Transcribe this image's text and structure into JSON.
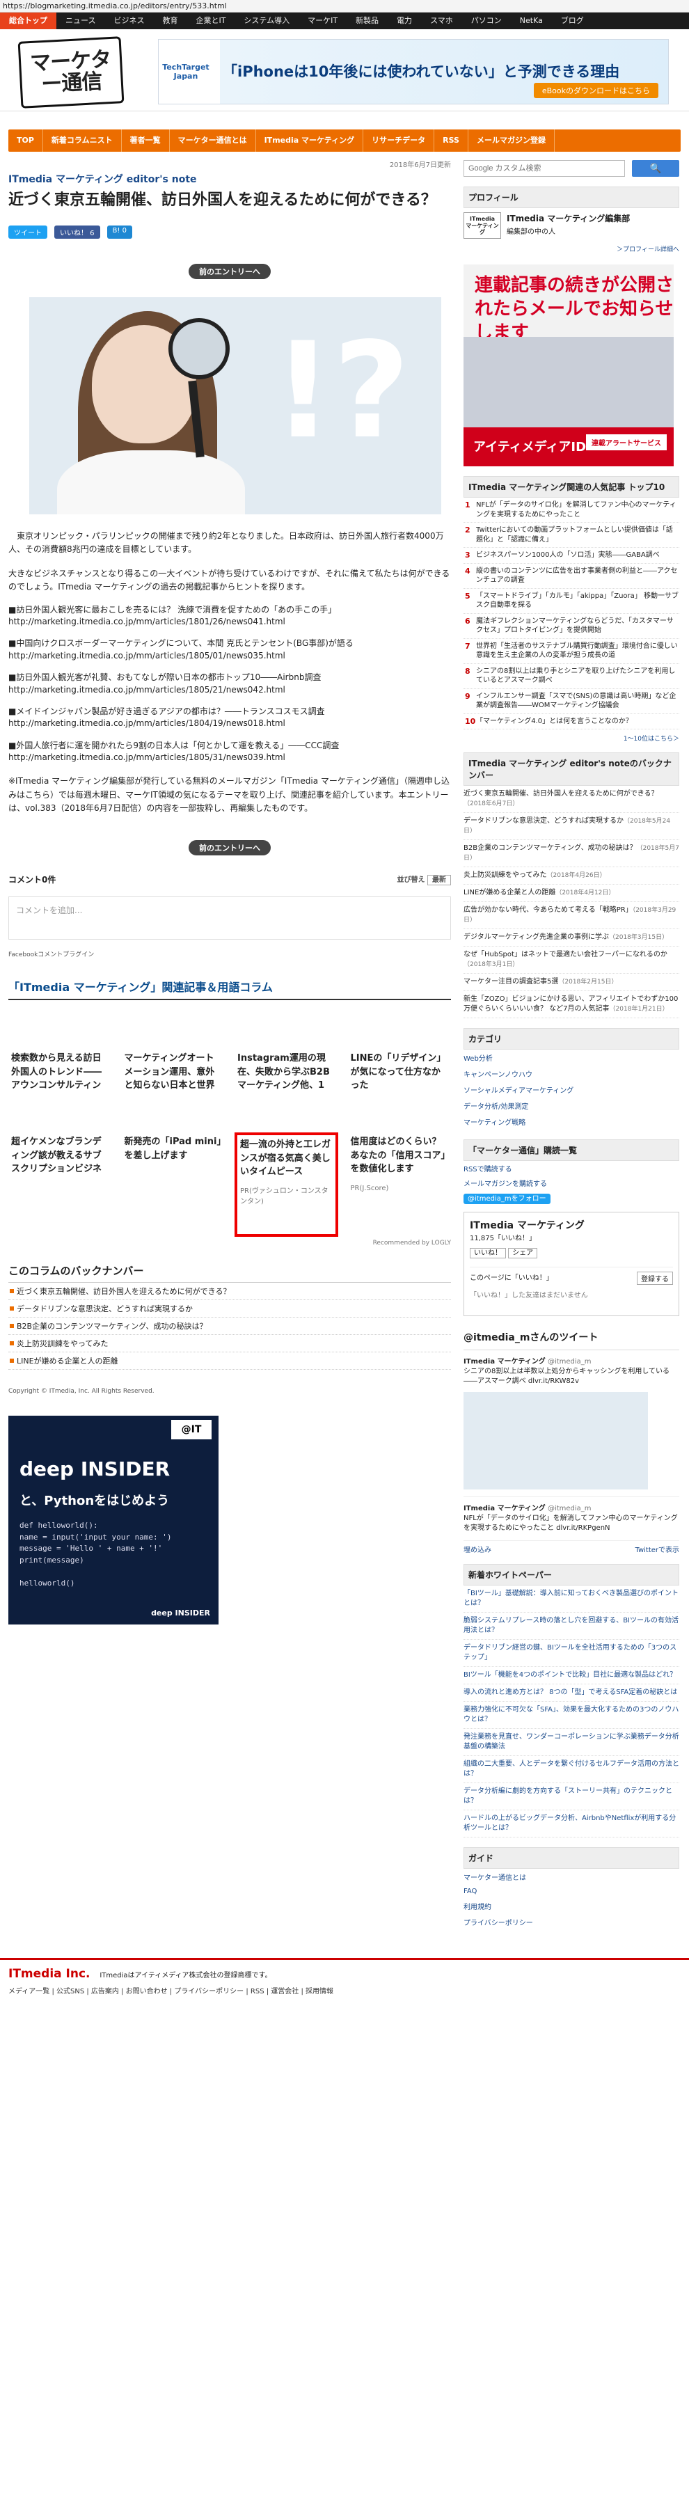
{
  "url": "https://blogmarketing.itmedia.co.jp/editors/entry/533.html",
  "topnav": [
    "総合トップ",
    "ニュース",
    "ビジネス",
    "教育",
    "企業とIT",
    "システム導入",
    "マーケIT",
    "新製品",
    "電力",
    "スマホ",
    "パソコン",
    "NetKa",
    "ブログ"
  ],
  "logo": "マーケター通信",
  "banner": {
    "brand": "TechTarget Japan",
    "title": "「iPhoneは10年後には使われていない」と予測できる理由",
    "button": "eBookのダウンロードはこちら"
  },
  "orangenav": [
    "TOP",
    "新着コラムニスト",
    "著者一覧",
    "マーケター通信とは",
    "ITmedia マーケティング",
    "リサーチデータ",
    "RSS",
    "メールマガジン登録"
  ],
  "article": {
    "date": "2018年6月7日更新",
    "series": "ITmedia マーケティング editor's note",
    "title": "近づく東京五輪開催、訪日外国人を迎えるために何ができる？",
    "share": [
      "ツイート",
      "いいね！ 6",
      "B! 0"
    ],
    "prev": "前のエントリーへ",
    "lead": "東京オリンピック・パラリンピックの開催まで残り約2年となりました。日本政府は、訪日外国人旅行者数4000万人、その消費額8兆円の達成を目標としています。",
    "p2": "大きなビジネスチャンスとなり得るこの一大イベントが待ち受けているわけですが、それに備えて私たちは何ができるのでしょう。ITmedia マーケティングの過去の掲載記事からヒントを探ります。",
    "items": [
      {
        "k": "■訪日外国人観光客に最おこしを売るには？ 洗練で消費を促すための「あの手この手」",
        "u": "http://marketing.itmedia.co.jp/mm/articles/1801/26/news041.html"
      },
      {
        "k": "■中国向けクロスボーダーマーケティングについて、本間 克氏とテンセント(BG事部)が語る",
        "u": "http://marketing.itmedia.co.jp/mm/articles/1805/01/news035.html"
      },
      {
        "k": "■訪日外国人観光客が礼賛、おもてなしが際い日本の都市トップ10――Airbnb調査",
        "u": "http://marketing.itmedia.co.jp/mm/articles/1805/21/news042.html"
      },
      {
        "k": "■メイドインジャパン製品が好き過ぎるアジアの都市は？――トランスコスモス調査",
        "u": "http://marketing.itmedia.co.jp/mm/articles/1804/19/news018.html"
      },
      {
        "k": "■外国人旅行者に運を開かれたら9割の日本人は「何とかして運を教える」――CCC調査",
        "u": "http://marketing.itmedia.co.jp/mm/articles/1805/31/news039.html"
      }
    ],
    "closing": "※ITmedia マーケティング編集部が発行している無料のメールマガジン「ITmedia マーケティング通信」（隔週申し込みはこちら）では毎週木曜日、マーケIT領域の気になるテーマを取り上げ、関連記事を紹介しています。本エントリーは、vol.383（2018年6月7日配信）の内容を一部抜粋し、再編集したものです。",
    "prev2": "前のエントリーへ"
  },
  "comments": {
    "count": "コメント0件",
    "sort_label": "並び替え",
    "sort_value": "最新",
    "placeholder": "コメントを追加...",
    "plugin": "Facebookコメントプラグイン"
  },
  "related": {
    "heading": "「ITmedia マーケティング」関連記事＆用語コラム",
    "cards": [
      {
        "t": "検索数から見える訪日外国人のトレンド――アウンコンサルティン",
        "pr": ""
      },
      {
        "t": "マーケティングオートメーション運用、意外と知らない日本と世界",
        "pr": ""
      },
      {
        "t": "Instagram運用の現在、失敗から学ぶB2Bマーケティング他、1",
        "pr": ""
      },
      {
        "t": "LINEの「リデザイン」が気になって仕方なかった",
        "pr": ""
      },
      {
        "t": "超イケメンなブランディング該が教えるサブスクリプションビジネ",
        "pr": ""
      },
      {
        "t": "新発売の「iPad mini」を差し上げます",
        "pr": ""
      },
      {
        "t": "超一流の外持と工レガンスが宿る気高く美しいタイムピース",
        "pr": "PR(ヴァシュロン・コンスタンタン)"
      },
      {
        "t": "信用度はどのくらい？あなたの「信用スコア」を数値化します",
        "pr": "PR(J.Score)"
      }
    ],
    "reco": "Recommended by LOGLY"
  },
  "backnumber": {
    "heading": "このコラムのバックナンバー",
    "items": [
      "近づく東京五輪開催、訪日外国人を迎えるために何ができる？",
      "データドリブンな意思決定、どうすれば実現するか",
      "B2B企業のコンテンツマーケティング、成功の秘訣は？",
      "炎上防災訓練をやってみた",
      "LINEが嫌める企業と人の距離"
    ]
  },
  "copyright": "Copyright © ITmedia, Inc. All Rights Reserved.",
  "bottom_ad": {
    "badge": "@IT",
    "title": "deep INSIDER",
    "sub": "と、Pythonをはじめよう",
    "code": [
      "def helloworld():",
      "    name = input('input your name: ')",
      "    message = 'Hello ' + name + '!'",
      "    print(message)",
      "",
      "helloworld()"
    ],
    "brand": "deep INSIDER"
  },
  "sidebar": {
    "search_placeholder": "Google カスタム検索",
    "profile_h": "プロフィール",
    "profile_name": "ITmedia マーケティング編集部",
    "profile_role": "編集部の中の人",
    "profile_more": "＞プロフィール詳細へ",
    "ad": {
      "title": "連載記事の続きが公開されたらメールでお知らせします",
      "brand": "アイティメディアID",
      "cta": "連載アラートサービス"
    },
    "rank_h": "ITmedia マーケティング関連の人気記事 トップ10",
    "rank": [
      "NFLが「データのサイロ化」を解消してファン中心のマーケティングを実現するためにやったこと",
      "Twitterにおいての動画プラットフォームとしい提供価値は「話題化」と「認識に備え」",
      "ビジネスパーソン1000人の「ソロ活」実態――GABA調べ",
      "縦の書いのコンテンツに広告を出す事業者側の利益と――アクセンチュアの調査",
      "「スマートドライブ」「カルモ」「akippa」「Zuora」 移動一サブスク自動車を探る",
      "魔法ギフレクションマーケティングならどうだ、「カスタマーサクセス」プロトタイピング」を提供開始",
      "世界初「生活者のサステナブル購買行動調査」環境付合に優しい意識を生え主企業の人の変革が担う成長の道",
      "シニアの8割以上は乗り手とシニアを取り上げたシニアを利用しているとアスマーク調べ",
      "インフルエンサー調査「スマで(SNS)の意識は高い時期」など企業が調査報告――WOMマーケティング協議会",
      "「マーケティング4.0」とは何を言うことなのか？"
    ],
    "rank_note": "1～10位はこちら＞",
    "en_h": "ITmedia マーケティング editor's noteのバックナンバー",
    "en_list": [
      [
        "近づく東京五輪開催、訪日外国人を迎えるために何ができる？",
        "（2018年6月7日）"
      ],
      [
        "データドリブンな意思決定、どうすれば実現するか",
        "（2018年5月24日）"
      ],
      [
        "B2B企業のコンテンツマーケティング、成功の秘訣は？",
        "（2018年5月7日）"
      ],
      [
        "炎上防災訓練をやってみた",
        "（2018年4月26日）"
      ],
      [
        "LINEが嫌める企業と人の距離",
        "（2018年4月12日）"
      ],
      [
        "広告が効かない時代、今あらためて考える「戦略PR」",
        "（2018年3月29日）"
      ],
      [
        "デジタルマーケティング先進企業の事例に学ぶ",
        "（2018年3月15日）"
      ],
      [
        "なぜ「HubSpot」はネットで最適たい会社フーパーになれるのか",
        "（2018年3月1日）"
      ],
      [
        "マーケター注目の調査記事5選",
        "（2018年2月15日）"
      ],
      [
        "新生「ZOZO」ビジョンにかける思い、アフィリエイトでわずか100万便ぐらいくらいいい食？ など7月の人気記事",
        "（2018年1月21日）"
      ]
    ],
    "cat_h": "カテゴリ",
    "cats": [
      "Web分析",
      "キャンペーンノウハウ",
      "ソーシャルメディアマーケティング",
      "データ分析/効果測定",
      "マーケティング戦略"
    ],
    "sub_h": "「マーケター通信」購読一覧",
    "subs": [
      "RSSで購読する",
      "メールマガジンを購読する",
      "@itmedia_mをフォロー"
    ],
    "fb": {
      "name": "ITmedia マーケティング",
      "likes": "11,875「いいね！」",
      "like_btn": "いいね！",
      "share_btn": "シェア",
      "note": "このページに「いいね！」",
      "login": "登録する",
      "friends": "「いいね！」した友達はまだいません"
    },
    "tw_h": "@itmedia_mさんのツイート",
    "tweets": [
      {
        "name": "ITmedia マーケティング",
        "handle": "@itmedia_m",
        "text": "シニアの8割以上は半数以上処分からキャッシングを利用している――アスマーク調べ dlvr.it/RKW82v"
      },
      {
        "name": "ITmedia マーケティング",
        "handle": "@itmedia_m",
        "text": "NFLが「データのサイロ化」を解消してファン中心のマーケティングを実現するためにやったこと dlvr.it/RKPgenN"
      }
    ],
    "tw_embed": "埋め込み",
    "tw_view": "Twitterで表示",
    "wp_h": "新着ホワイトペーパー",
    "wp": [
      "「BIツール」基礎解説：導入前に知っておくべき製品選びのポイントとは？",
      "脆弱システムリプレース時の落とし穴を回避する、BIツールの有効活用法とは？",
      "データドリブン経営の鍵、BIツールを全社活用するための「3つのステップ」",
      "BIツール「機能を4つのポイントで比較」目社に最適な製品はどれ？",
      "導入の流れと進め方とは？ 8つの「型」で考えるSFA定着の秘訣とは",
      "業務力強化に不可欠な「SFA」、効果を最大化するための3つのノウハウとは？",
      "発注業務を見直せ、ワンダーコーポレーションに学ぶ業務データ分析基盤の構築法",
      "組織の二大重要、人とデータを繋ぐ付けるセルフデータ活用の方法とは？",
      "データ分析編に劇的を方向する「ストーリー共有」のテクニックとは？",
      "ハードルの上がるビッグデータ分析、AirbnbやNetflixが利用する分析ツールとは？"
    ],
    "guide_h": "ガイド",
    "guide": [
      "マーケター通信とは",
      "FAQ",
      "利用規約",
      "プライバシーポリシー"
    ]
  },
  "footer": {
    "brand": "ITmedia Inc.",
    "tag": "ITmediaはアイティメディア株式会社の登録商標です。",
    "links": "メディア一覧 | 公式SNS | 広告案内 | お問い合わせ | プライバシーポリシー | RSS | 運営会社 | 採用情報"
  }
}
